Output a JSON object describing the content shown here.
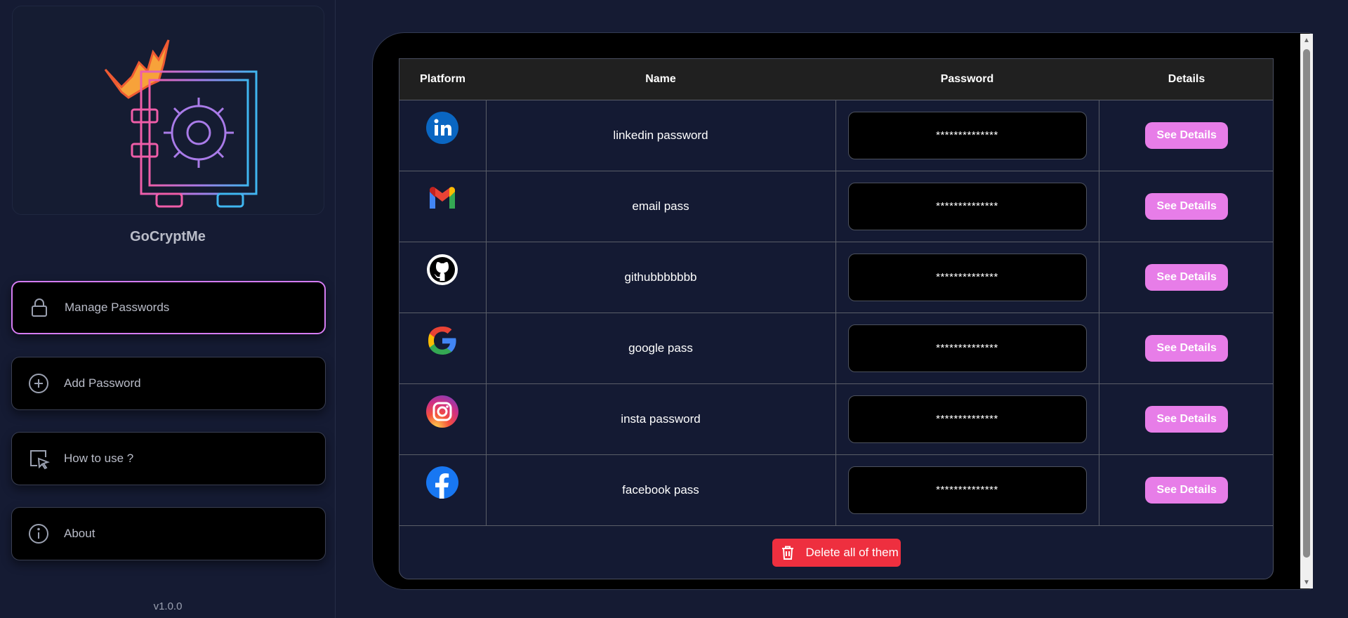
{
  "app": {
    "name": "GoCryptMe",
    "version": "v1.0.0"
  },
  "nav": [
    {
      "label": "Manage Passwords",
      "icon": "lock-icon",
      "active": true
    },
    {
      "label": "Add Password",
      "icon": "plus-circle-icon",
      "active": false
    },
    {
      "label": "How to use ?",
      "icon": "cursor-click-icon",
      "active": false
    },
    {
      "label": "About",
      "icon": "info-icon",
      "active": false
    }
  ],
  "table": {
    "headers": {
      "platform": "Platform",
      "name": "Name",
      "password": "Password",
      "details": "Details"
    },
    "rows": [
      {
        "platform_icon": "linkedin-icon",
        "name": "linkedin password",
        "password": "**************",
        "action": "See Details"
      },
      {
        "platform_icon": "gmail-icon",
        "name": "email pass",
        "password": "**************",
        "action": "See Details"
      },
      {
        "platform_icon": "github-icon",
        "name": "githubbbbbbb",
        "password": "**************",
        "action": "See Details"
      },
      {
        "platform_icon": "google-icon",
        "name": "google pass",
        "password": "**************",
        "action": "See Details"
      },
      {
        "platform_icon": "instagram-icon",
        "name": "insta password",
        "password": "**************",
        "action": "See Details"
      },
      {
        "platform_icon": "facebook-icon",
        "name": "facebook pass",
        "password": "**************",
        "action": "See Details"
      }
    ],
    "delete_all_label": "Delete all of them"
  },
  "colors": {
    "background": "#151b33",
    "accent": "#e77de8",
    "danger": "#ee2f3f",
    "active_border": "#d57cf2"
  }
}
